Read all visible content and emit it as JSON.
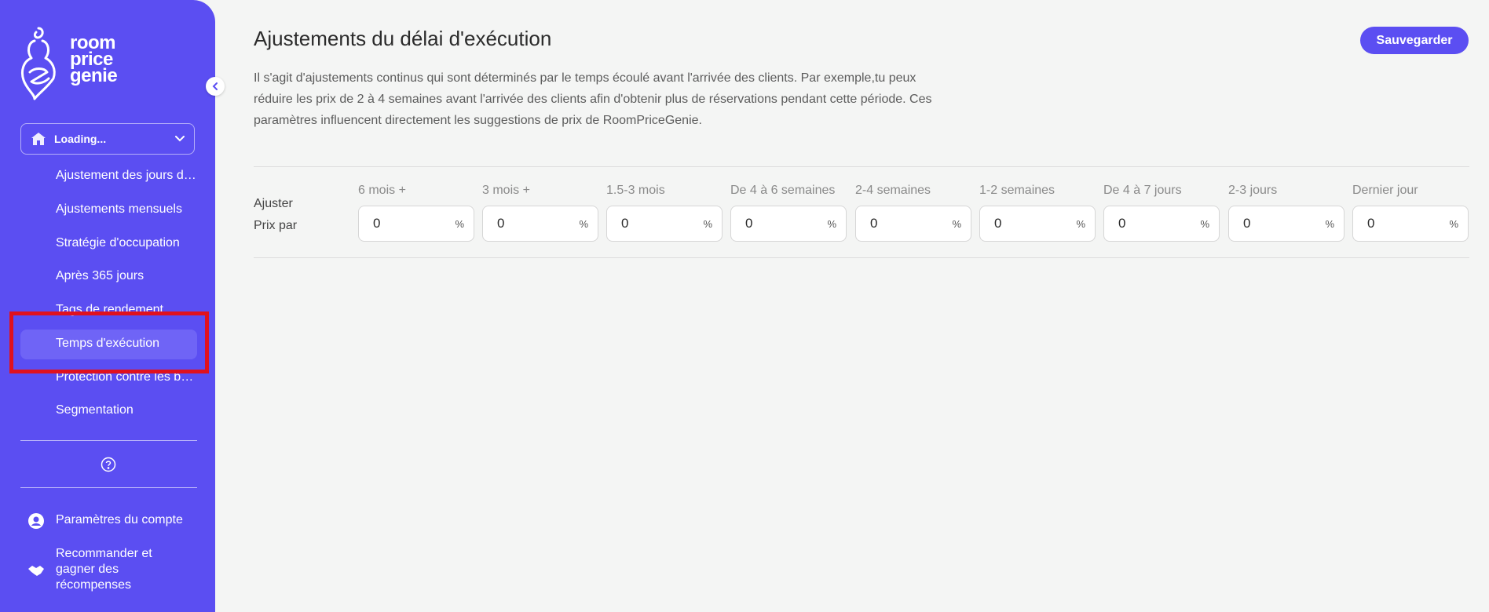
{
  "brand": {
    "line1": "room",
    "line2": "price",
    "line3": "genie"
  },
  "sidebar": {
    "property_select": "Loading...",
    "items": [
      {
        "label": "Ajustement des jours de la semaine"
      },
      {
        "label": "Ajustements mensuels"
      },
      {
        "label": "Stratégie d'occupation"
      },
      {
        "label": "Après 365 jours"
      },
      {
        "label": "Tags de rendement"
      },
      {
        "label": "Temps d'exécution"
      },
      {
        "label": "Protection contre les baisses"
      },
      {
        "label": "Segmentation"
      }
    ],
    "account_settings": "Paramètres du compte",
    "refer": "Recommander et gagner des récompenses"
  },
  "main": {
    "title": "Ajustements du délai d'exécution",
    "description": "Il s'agit d'ajustements continus qui sont déterminés par le temps écoulé avant l'arrivée des clients. Par exemple,tu peux réduire les prix de 2 à 4 semaines avant l'arrivée des clients afin d'obtenir plus de réservations pendant cette période. Ces paramètres influencent directement les suggestions de prix de RoomPriceGenie.",
    "save_label": "Sauvegarder",
    "row_label_line1": "Ajuster",
    "row_label_line2": "Prix par",
    "unit": "%",
    "columns": [
      {
        "header": "6 mois +",
        "value": "0"
      },
      {
        "header": "3 mois +",
        "value": "0"
      },
      {
        "header": "1.5-3 mois",
        "value": "0"
      },
      {
        "header": "De 4 à 6 semaines",
        "value": "0"
      },
      {
        "header": "2-4 semaines",
        "value": "0"
      },
      {
        "header": "1-2 semaines",
        "value": "0"
      },
      {
        "header": "De 4 à 7 jours",
        "value": "0"
      },
      {
        "header": "2-3 jours",
        "value": "0"
      },
      {
        "header": "Dernier jour",
        "value": "0"
      }
    ]
  },
  "colors": {
    "brand": "#5b4ef2",
    "highlight": "#e0111e",
    "background": "#f4f5f4"
  }
}
